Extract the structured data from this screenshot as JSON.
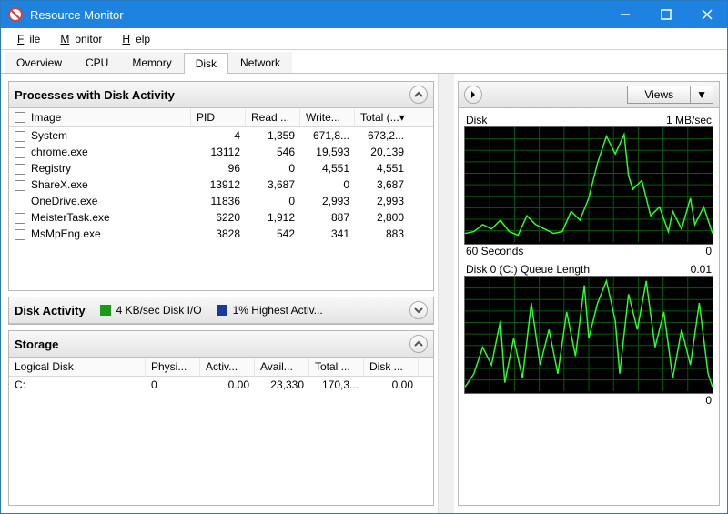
{
  "window": {
    "title": "Resource Monitor"
  },
  "menu": {
    "file": "File",
    "monitor": "Monitor",
    "help": "Help"
  },
  "tabs": {
    "overview": "Overview",
    "cpu": "CPU",
    "memory": "Memory",
    "disk": "Disk",
    "network": "Network"
  },
  "sections": {
    "processes": {
      "title": "Processes with Disk Activity",
      "headers": {
        "image": "Image",
        "pid": "PID",
        "read": "Read ...",
        "write": "Write...",
        "total": "Total (..."
      },
      "rows": [
        {
          "image": "System",
          "pid": "4",
          "read": "1,359",
          "write": "671,8...",
          "total": "673,2..."
        },
        {
          "image": "chrome.exe",
          "pid": "13112",
          "read": "546",
          "write": "19,593",
          "total": "20,139"
        },
        {
          "image": "Registry",
          "pid": "96",
          "read": "0",
          "write": "4,551",
          "total": "4,551"
        },
        {
          "image": "ShareX.exe",
          "pid": "13912",
          "read": "3,687",
          "write": "0",
          "total": "3,687"
        },
        {
          "image": "OneDrive.exe",
          "pid": "11836",
          "read": "0",
          "write": "2,993",
          "total": "2,993"
        },
        {
          "image": "MeisterTask.exe",
          "pid": "6220",
          "read": "1,912",
          "write": "887",
          "total": "2,800"
        },
        {
          "image": "MsMpEng.exe",
          "pid": "3828",
          "read": "542",
          "write": "341",
          "total": "883"
        }
      ]
    },
    "disk_activity": {
      "title": "Disk Activity",
      "legend1": "4 KB/sec Disk I/O",
      "legend1_color": "#1a9a1a",
      "legend2": "1% Highest Activ...",
      "legend2_color": "#1a3a9a"
    },
    "storage": {
      "title": "Storage",
      "headers": {
        "logical": "Logical Disk",
        "physi": "Physi...",
        "activ": "Activ...",
        "avail": "Avail...",
        "total": "Total ...",
        "disk": "Disk ..."
      },
      "rows": [
        {
          "logical": "C:",
          "physi": "0",
          "activ": "0.00",
          "avail": "23,330",
          "total": "170,3...",
          "disk": "0.00"
        }
      ]
    }
  },
  "right": {
    "views": "Views",
    "graph1": {
      "topL": "Disk",
      "topR": "1 MB/sec",
      "botL": "60 Seconds",
      "botR": "0"
    },
    "graph2": {
      "topL": "Disk 0 (C:) Queue Length",
      "topR": "0.01",
      "botR": "0"
    }
  }
}
